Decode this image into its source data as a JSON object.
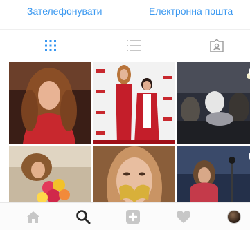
{
  "contact": {
    "call_label": "Зателефонувати",
    "email_label": "Електронна пошта"
  },
  "view_tabs": {
    "active": "grid",
    "items": [
      {
        "id": "grid",
        "icon": "grid-view-icon"
      },
      {
        "id": "list",
        "icon": "list-view-icon"
      },
      {
        "id": "tagged",
        "icon": "tagged-photos-icon"
      }
    ]
  },
  "grid": {
    "tiles": [
      {
        "id": "t1",
        "content": "photo",
        "multi": false
      },
      {
        "id": "t2",
        "content": "photo",
        "multi": false
      },
      {
        "id": "t3",
        "content": "photo",
        "multi": true
      },
      {
        "id": "t4",
        "content": "photo",
        "multi": false
      },
      {
        "id": "t5",
        "content": "photo",
        "multi": false
      },
      {
        "id": "t6",
        "content": "photo",
        "multi": true
      }
    ]
  },
  "bottom_nav": {
    "active": "search",
    "items": [
      {
        "id": "home",
        "icon": "home-icon"
      },
      {
        "id": "search",
        "icon": "search-icon"
      },
      {
        "id": "add",
        "icon": "add-post-icon"
      },
      {
        "id": "activity",
        "icon": "heart-icon"
      },
      {
        "id": "profile",
        "icon": "profile-avatar"
      }
    ]
  },
  "colors": {
    "accent": "#3897f0",
    "inactive_icon": "#c7c7c7",
    "active_icon": "#262626"
  }
}
